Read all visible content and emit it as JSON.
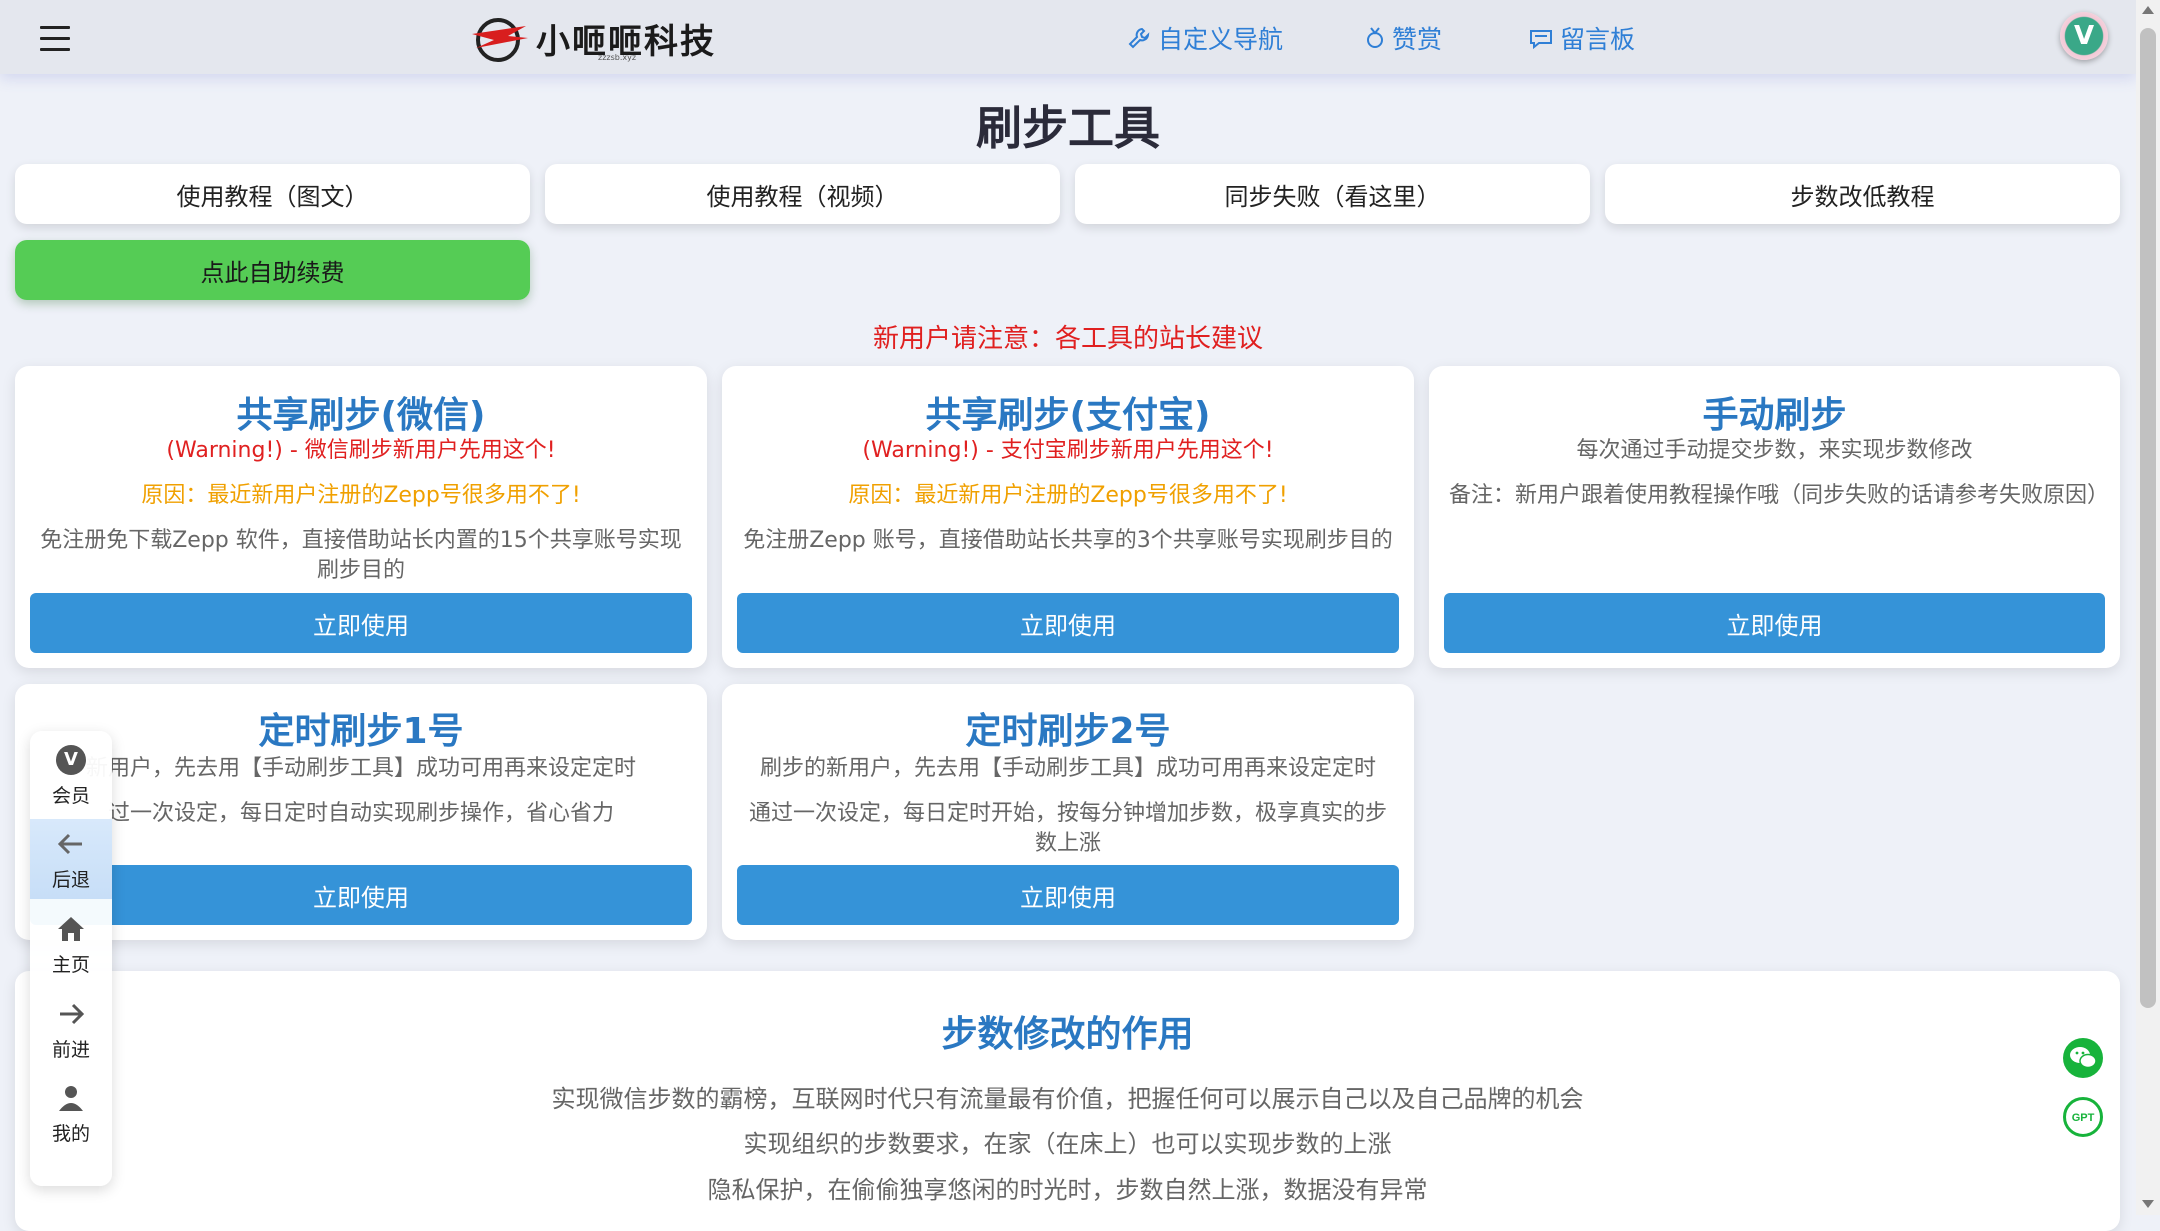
{
  "header": {
    "logo_text": "小咂咂科技",
    "logo_sub": "zzzsb.xyz",
    "nav": [
      {
        "label": "自定义导航",
        "icon": "wrench-icon"
      },
      {
        "label": "赞赏",
        "icon": "medal-icon"
      },
      {
        "label": "留言板",
        "icon": "message-icon"
      }
    ],
    "avatar_letter": "V"
  },
  "page_title": "刷步工具",
  "top_buttons": [
    "使用教程（图文）",
    "使用教程（视频）",
    "同步失败（看这里）",
    "步数改低教程"
  ],
  "renew_button": "点此自助续费",
  "notice": "新用户请注意：各工具的站长建议",
  "cards": [
    {
      "title": "共享刷步(微信)",
      "warning": "(Warning!) - 微信刷步新用户先用这个!",
      "reason": "原因：最近新用户注册的Zepp号很多用不了!",
      "desc": "免注册免下载Zepp 软件，直接借助站长内置的15个共享账号实现刷步目的",
      "button": "立即使用"
    },
    {
      "title": "共享刷步(支付宝)",
      "warning": "(Warning!) - 支付宝刷步新用户先用这个!",
      "reason": "原因：最近新用户注册的Zepp号很多用不了!",
      "desc": "免注册Zepp 账号，直接借助站长共享的3个共享账号实现刷步目的",
      "button": "立即使用"
    },
    {
      "title": "手动刷步",
      "line1": "每次通过手动提交步数，来实现步数修改",
      "line2": "备注：新用户跟着使用教程操作哦（同步失败的话请参考失败原因）",
      "button": "立即使用"
    },
    {
      "title": "定时刷步1号",
      "line1": "新用户，先去用【手动刷步工具】成功可用再来设定定时",
      "line2": "过一次设定，每日定时自动实现刷步操作，省心省力",
      "button": "立即使用"
    },
    {
      "title": "定时刷步2号",
      "line1": "刷步的新用户，先去用【手动刷步工具】成功可用再来设定定时",
      "line2": "通过一次设定，每日定时开始，按每分钟增加步数，极享真实的步数上涨",
      "button": "立即使用"
    }
  ],
  "section": {
    "title": "步数修改的作用",
    "lines": [
      "实现微信步数的霸榜，互联网时代只有流量最有价值，把握任何可以展示自己以及自己品牌的机会",
      "实现组织的步数要求，在家（在床上）也可以实现步数的上涨",
      "隐私保护，在偷偷独享悠闲的时光时，步数自然上涨，数据没有异常"
    ]
  },
  "sidenav": [
    {
      "label": "会员",
      "icon": "vip-icon",
      "badge": "V"
    },
    {
      "label": "后退",
      "icon": "arrow-left-icon"
    },
    {
      "label": "主页",
      "icon": "home-icon"
    },
    {
      "label": "前进",
      "icon": "arrow-right-icon"
    },
    {
      "label": "我的",
      "icon": "user-icon"
    }
  ],
  "float_icons": [
    {
      "icon": "wechat-icon",
      "label": ""
    },
    {
      "icon": "gpt-chat-icon",
      "label": "GPT"
    }
  ],
  "colors": {
    "accent_blue": "#3593d8",
    "title_blue": "#2a78c2",
    "warning_red": "#e02020",
    "reason_orange": "#f0a000",
    "renew_green": "#55cc55"
  }
}
